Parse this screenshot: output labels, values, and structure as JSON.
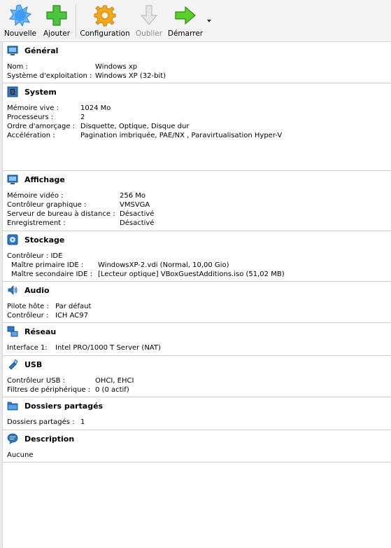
{
  "toolbar": {
    "new_label": "Nouvelle",
    "add_label": "Ajouter",
    "config_label": "Configuration",
    "discard_label": "Oublier",
    "start_label": "Démarrer"
  },
  "general": {
    "title": "Général",
    "rows": [
      {
        "key": "Nom :",
        "value": "Windows xp"
      },
      {
        "key": "Système d'exploitation :",
        "value": "Windows XP (32-bit)"
      }
    ]
  },
  "system": {
    "title": "System",
    "rows": [
      {
        "key": "Mémoire vive :",
        "value": "1024 Mo"
      },
      {
        "key": "Processeurs :",
        "value": "2"
      },
      {
        "key": "Ordre d'amorçage :",
        "value": "Disquette, Optique, Disque dur"
      },
      {
        "key": "Accélération :",
        "value": "Pagination imbriquée, PAE/NX , Paravirtualisation Hyper-V"
      }
    ]
  },
  "display": {
    "title": "Affichage",
    "rows": [
      {
        "key": "Mémoire vidéo :",
        "value": "256 Mo"
      },
      {
        "key": "Contrôleur graphique :",
        "value": "VMSVGA"
      },
      {
        "key": "Serveur de bureau à distance :",
        "value": "Désactivé"
      },
      {
        "key": "Enregistrement :",
        "value": "Désactivé"
      }
    ]
  },
  "storage": {
    "title": "Stockage",
    "controller": "Contrôleur : IDE",
    "rows": [
      {
        "key": "Maître primaire IDE :",
        "value": "WindowsXP-2.vdi (Normal, 10,00 Gio)"
      },
      {
        "key": "Maître secondaire IDE :",
        "value": "[Lecteur optique] VBoxGuestAdditions.iso (51,02 MB)"
      }
    ]
  },
  "audio": {
    "title": "Audio",
    "rows": [
      {
        "key": "Pilote hôte :",
        "value": "Par défaut"
      },
      {
        "key": "Contrôleur :",
        "value": "ICH AC97"
      }
    ]
  },
  "network": {
    "title": "Réseau",
    "rows": [
      {
        "key": "Interface 1:",
        "value": "Intel PRO/1000 T Server (NAT)"
      }
    ]
  },
  "usb": {
    "title": "USB",
    "rows": [
      {
        "key": "Contrôleur USB :",
        "value": "OHCI, EHCI"
      },
      {
        "key": "Filtres de périphérique :",
        "value": "0 (0 actif)"
      }
    ]
  },
  "shared": {
    "title": "Dossiers partagés",
    "rows": [
      {
        "key": "Dossiers partagés :",
        "value": "1"
      }
    ]
  },
  "description": {
    "title": "Description",
    "text": "Aucune"
  }
}
